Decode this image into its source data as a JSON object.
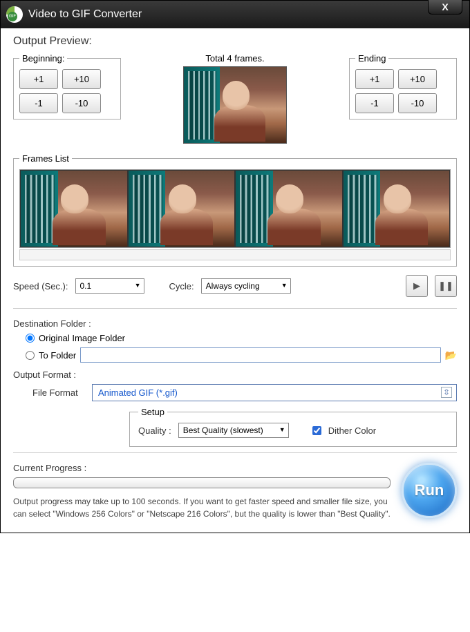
{
  "window": {
    "title": "Video to GIF Converter",
    "close": "X"
  },
  "preview": {
    "heading": "Output Preview:",
    "beginning": {
      "legend": "Beginning:",
      "plus1": "+1",
      "plus10": "+10",
      "minus1": "-1",
      "minus10": "-10"
    },
    "center_label": "Total 4 frames.",
    "ending": {
      "legend": "Ending",
      "plus1": "+1",
      "plus10": "+10",
      "minus1": "-1",
      "minus10": "-10"
    }
  },
  "frames": {
    "legend": "Frames List"
  },
  "controls": {
    "speed_label": "Speed (Sec.):",
    "speed_value": "0.1",
    "cycle_label": "Cycle:",
    "cycle_value": "Always cycling"
  },
  "destination": {
    "heading": "Destination Folder :",
    "option_original": "Original Image Folder",
    "option_tofolder": "To Folder",
    "folder_value": ""
  },
  "output": {
    "heading": "Output Format :",
    "fileformat_label": "File Format",
    "fileformat_value": "Animated GIF (*.gif)",
    "setup_legend": "Setup",
    "quality_label": "Quality :",
    "quality_value": "Best Quality (slowest)",
    "dither_label": "Dither Color",
    "dither_checked": true
  },
  "progress": {
    "heading": "Current Progress :",
    "hint": "Output progress may take up to 100 seconds. If you want to get faster speed and smaller file size, you can select \"Windows 256 Colors\" or \"Netscape 216 Colors\", but the quality is lower than \"Best Quality\"."
  },
  "run": {
    "label": "Run"
  }
}
